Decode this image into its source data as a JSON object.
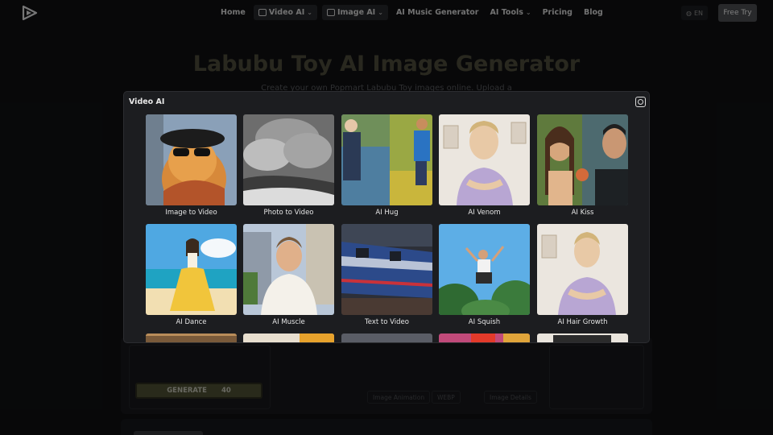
{
  "header": {
    "nav": [
      {
        "label": "Home"
      },
      {
        "label": "Video AI"
      },
      {
        "label": "Image AI"
      },
      {
        "label": "AI Music Generator"
      },
      {
        "label": "AI Tools"
      },
      {
        "label": "Pricing"
      },
      {
        "label": "Blog"
      }
    ],
    "language": "EN",
    "free_try": "Free Try"
  },
  "hero": {
    "title": "Labubu Toy AI Image Generator",
    "subtitle": "Create your own Popmart Labubu Toy images online. Upload a"
  },
  "tool": {
    "generate_label": "GENERATE",
    "generate_cost": "40",
    "chips": [
      "Image Animation",
      "WEBP",
      "Image Details"
    ]
  },
  "modal": {
    "title": "Video AI",
    "items": [
      {
        "label": "Image to Video"
      },
      {
        "label": "Photo to Video"
      },
      {
        "label": "AI Hug"
      },
      {
        "label": "AI Venom"
      },
      {
        "label": "AI Kiss"
      },
      {
        "label": "AI Dance"
      },
      {
        "label": "AI Muscle"
      },
      {
        "label": "Text to Video"
      },
      {
        "label": "AI Squish"
      },
      {
        "label": "AI Hair Growth"
      }
    ]
  },
  "colors": {
    "accent": "#4c4e32",
    "modal_bg": "#1c1d20",
    "page_bg": "#0f1012"
  }
}
